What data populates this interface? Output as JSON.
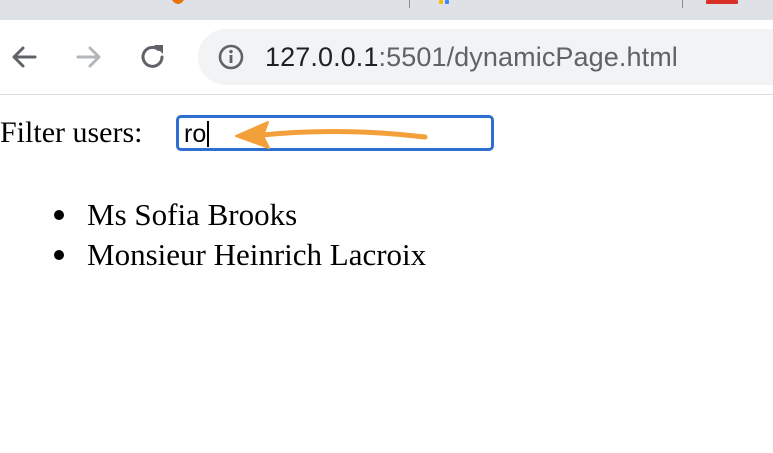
{
  "browser": {
    "address_bar": {
      "host": "127.0.0.1",
      "path": ":5501/dynamicPage.html"
    }
  },
  "page": {
    "filter": {
      "label": "Filter users:",
      "value": "ro"
    },
    "users": [
      "Ms Sofia Brooks",
      "Monsieur Heinrich Lacroix"
    ]
  },
  "annotation": {
    "arrow_color": "#f4a03a",
    "icon": "arrow-left-icon"
  },
  "colors": {
    "focus_ring": "#2f6fd1",
    "tabstrip": "#dee1e6",
    "omnibox": "#f1f3f4"
  }
}
